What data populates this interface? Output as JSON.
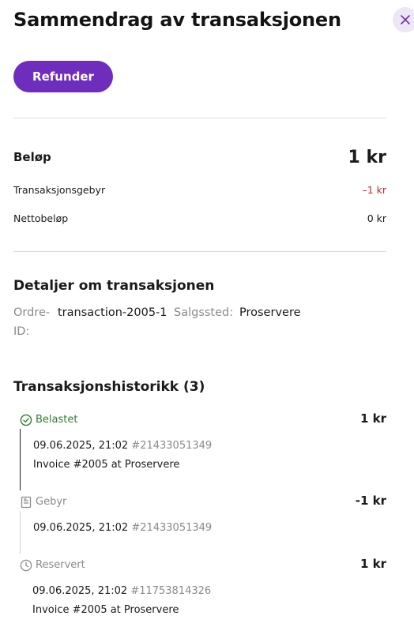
{
  "header": {
    "title": "Sammendrag av transaksjonen",
    "close_icon": "close-icon"
  },
  "actions": {
    "refund_label": "Refunder"
  },
  "summary": {
    "amount_label": "Beløp",
    "amount_value": "1 kr",
    "fee_label": "Transaksjonsgebyr",
    "fee_value": "–1 kr",
    "net_label": "Nettobeløp",
    "net_value": "0 kr"
  },
  "details": {
    "title": "Detaljer om transaksjonen",
    "order_id_label_line1": "Ordre-",
    "order_id_label_line2": "ID:",
    "order_id_value": "transaction-2005-1",
    "point_of_sale_label": "Salgssted:",
    "point_of_sale_value": "Proservere"
  },
  "history": {
    "title": "Transaksjonshistorikk (3)",
    "items": [
      {
        "status": "Belastet",
        "icon": "check-circle-icon",
        "amount": "1 kr",
        "datetime": "09.06.2025, 21:02",
        "reference": "#21433051349",
        "description": "Invoice #2005 at Proservere"
      },
      {
        "status": "Gebyr",
        "icon": "receipt-icon",
        "amount": "-1 kr",
        "datetime": "09.06.2025, 21:02",
        "reference": "#21433051349",
        "description": ""
      },
      {
        "status": "Reservert",
        "icon": "clock-icon",
        "amount": "1 kr",
        "datetime": "09.06.2025, 21:02",
        "reference": "#11753814326",
        "description": "Invoice #2005 at Proservere"
      }
    ]
  },
  "colors": {
    "accent": "#6f2dbd",
    "success": "#2e7d32",
    "negative": "#c62828",
    "muted": "#8a8a8a"
  }
}
